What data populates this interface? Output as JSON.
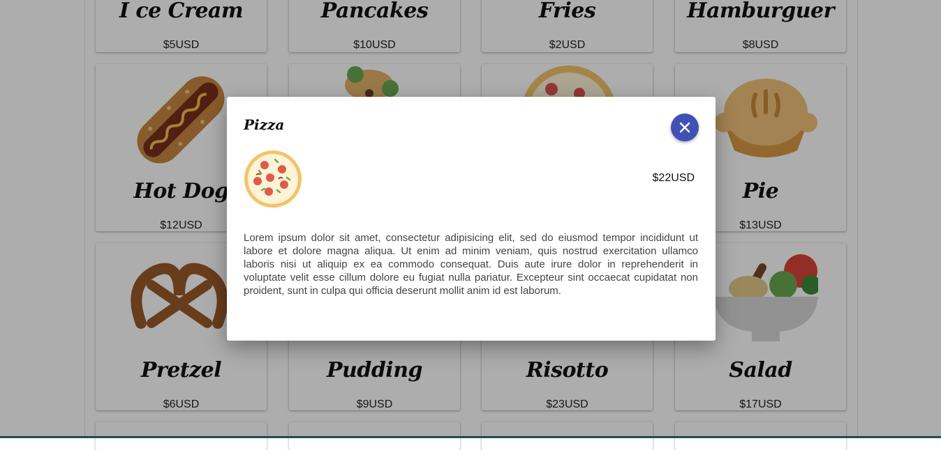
{
  "menu": {
    "row1": [
      {
        "name": "I ce Cream",
        "price": "$5USD"
      },
      {
        "name": "Pancakes",
        "price": "$10USD"
      },
      {
        "name": "Fries",
        "price": "$2USD"
      },
      {
        "name": "Hamburguer",
        "price": "$8USD"
      }
    ],
    "row2": [
      {
        "name": "Hot Dog",
        "price": "$12USD",
        "icon": "hot-dog-icon"
      },
      {
        "name": "",
        "price": "",
        "icon": "burrito-icon"
      },
      {
        "name": "",
        "price": "",
        "icon": "pizza-icon"
      },
      {
        "name": "Pie",
        "price": "$13USD",
        "icon": "pie-icon"
      }
    ],
    "row3": [
      {
        "name": "Pretzel",
        "price": "$6USD",
        "icon": "pretzel-icon"
      },
      {
        "name": "Pudding",
        "price": "$9USD",
        "icon": "pudding-icon"
      },
      {
        "name": "Risotto",
        "price": "$23USD",
        "icon": "risotto-icon"
      },
      {
        "name": "Salad",
        "price": "$17USD",
        "icon": "salad-icon"
      }
    ]
  },
  "modal": {
    "title": "Pizza",
    "price": "$22USD",
    "description": "Lorem ipsum dolor sit amet, consectetur adipisicing elit, sed do eiusmod tempor incididunt ut labore et dolore magna aliqua. Ut enim ad minim veniam, quis nostrud exercitation ullamco laboris nisi ut aliquip ex ea commodo consequat. Duis aute irure dolor in reprehenderit in voluptate velit esse cillum dolore eu fugiat nulla pariatur. Excepteur sint occaecat cupidatat non proident, sunt in culpa qui officia deserunt mollit anim id est laborum.",
    "close_icon": "close-icon",
    "accent_color": "#3f51b5"
  }
}
